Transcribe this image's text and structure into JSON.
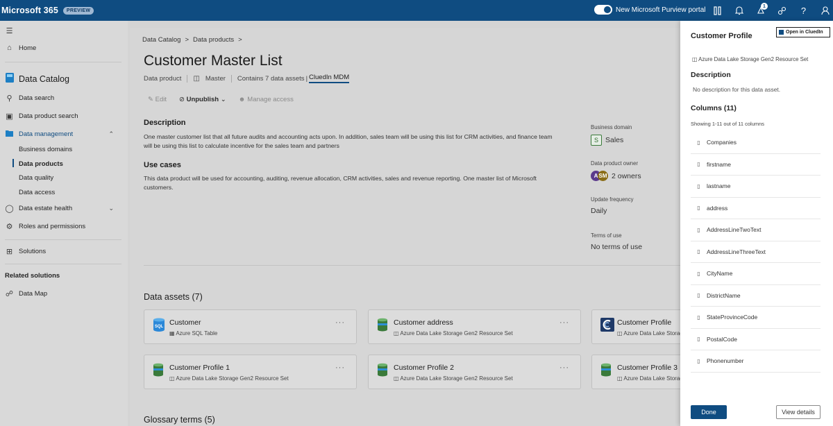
{
  "topbar": {
    "brand": "Microsoft 365",
    "badge": "PREVIEW",
    "toggle_label": "New Microsoft Purview portal",
    "notification_count": "1",
    "icons": [
      "compare-icon",
      "bell-icon",
      "notification-icon",
      "link-icon",
      "help-icon",
      "user-icon"
    ]
  },
  "nav": {
    "home": "Home",
    "app": "Data Catalog",
    "data_search": "Data search",
    "data_product_search": "Data product search",
    "data_management": "Data management",
    "sub_items": [
      "Business domains",
      "Data products",
      "Data quality",
      "Data access"
    ],
    "data_estate_health": "Data estate health",
    "roles": "Roles and permissions",
    "solutions": "Solutions",
    "related": "Related solutions",
    "data_map": "Data Map"
  },
  "main": {
    "breadcrumb": [
      "Data Catalog",
      ">",
      "Data products",
      ">"
    ],
    "title": "Customer Master List",
    "meta": {
      "type": "Data product",
      "class": "Master",
      "assets": "Contains 7 data assets",
      "link": "CluedIn MDM"
    },
    "toolbar": {
      "edit": "Edit",
      "unpublish": "Unpublish",
      "manage": "Manage access"
    },
    "description_head": "Description",
    "description": "One master customer list that all future audits and accounting acts upon. In addition, sales team will be using this list for CRM activities, and finance team will be using this list to calculate incentive for the sales team and partners",
    "usecases_head": "Use cases",
    "usecases": "This data product will be used for accounting, auditing, revenue allocation, CRM activities, sales and revenue reporting.  One master list of Microsoft customers.",
    "side": {
      "domain_label": "Business domain",
      "domain_badge": "S",
      "domain_value": "Sales",
      "owner_label": "Data product owner",
      "owner_initials": [
        "A",
        "SM"
      ],
      "owner_value": "2 owners",
      "freq_label": "Update frequency",
      "freq_value": "Daily",
      "terms_label": "Terms of use",
      "terms_value": "No terms of use"
    },
    "assets_head": "Data assets (7)",
    "assets": [
      {
        "title": "Customer",
        "sub": "Azure SQL Table",
        "icon": "sql"
      },
      {
        "title": "Customer address",
        "sub": "Azure Data Lake Storage Gen2 Resource Set",
        "icon": "db"
      },
      {
        "title": "Customer Profile",
        "sub": "Azure Data Lake Storag",
        "icon": "cluedin"
      },
      {
        "title": "Customer Profile 1",
        "sub": "Azure Data Lake Storage Gen2 Resource Set",
        "icon": "db"
      },
      {
        "title": "Customer Profile 2",
        "sub": "Azure Data Lake Storage Gen2 Resource Set",
        "icon": "db"
      },
      {
        "title": "Customer Profile 3",
        "sub": "Azure Data Lake Storag",
        "icon": "db"
      }
    ],
    "more": "···",
    "sql_label": "SQL",
    "glossary_head": "Glossary terms (5)"
  },
  "panel": {
    "title": "Customer Profile",
    "open_btn": "Open in CluedIn",
    "source": "Azure Data Lake Storage Gen2 Resource Set",
    "desc_head": "Description",
    "desc_text": "No description for this data asset.",
    "cols_head": "Columns (11)",
    "cols_count": "Showing 1-11 out of 11 columns",
    "columns": [
      "Companies",
      "firstname",
      "lastname",
      "address",
      "AddressLineTwoText",
      "AddressLineThreeText",
      "CityName",
      "DistrictName",
      "StateProvinceCode",
      "PostalCode",
      "Phonenumber"
    ],
    "done": "Done",
    "view": "View details"
  },
  "colors": {
    "brand": "#0f4c81",
    "nav_bg": "#d9d9d9",
    "panel_bg": "#ffffff"
  }
}
